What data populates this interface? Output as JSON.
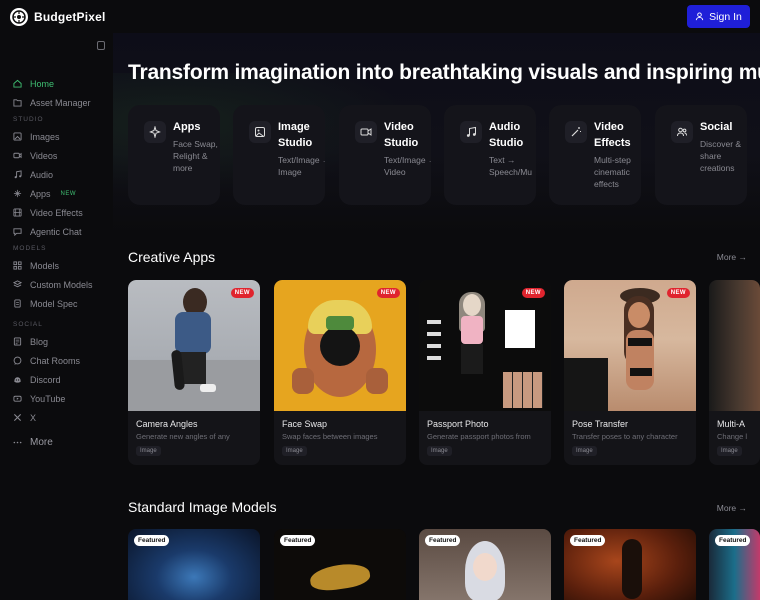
{
  "app": {
    "name": "BudgetPixel",
    "sign_in": "Sign In"
  },
  "sidebar": {
    "items_top": [
      {
        "label": "Home",
        "icon": "home-icon",
        "active": true
      },
      {
        "label": "Asset Manager",
        "icon": "folder-icon"
      }
    ],
    "section_studio": "STUDIO",
    "items_studio": [
      {
        "label": "Images",
        "icon": "image-icon"
      },
      {
        "label": "Videos",
        "icon": "video-icon"
      },
      {
        "label": "Audio",
        "icon": "music-icon"
      },
      {
        "label": "Apps",
        "icon": "sparkle-icon",
        "badge": "NEW"
      },
      {
        "label": "Video Effects",
        "icon": "film-icon"
      },
      {
        "label": "Agentic Chat",
        "icon": "chat-icon"
      }
    ],
    "section_models": "MODELS",
    "items_models": [
      {
        "label": "Models",
        "icon": "grid-icon"
      },
      {
        "label": "Custom Models",
        "icon": "layers-icon"
      },
      {
        "label": "Model Spec",
        "icon": "doc-icon"
      }
    ],
    "section_social": "SOCIAL",
    "items_social": [
      {
        "label": "Blog",
        "icon": "blog-icon"
      },
      {
        "label": "Chat Rooms",
        "icon": "chat-icon"
      },
      {
        "label": "Discord",
        "icon": "discord-icon"
      },
      {
        "label": "YouTube",
        "icon": "youtube-icon"
      },
      {
        "label": "X",
        "icon": "x-icon"
      }
    ],
    "more": "More"
  },
  "hero": {
    "title": "Transform imagination into breathtaking visuals and inspiring mu"
  },
  "studios": [
    {
      "title": "Apps",
      "desc": "Face Swap, Relight & more",
      "icon": "sparkle-icon"
    },
    {
      "title": "Image Studio",
      "desc": "Text/Image → Image",
      "icon": "image-icon"
    },
    {
      "title": "Video Studio",
      "desc": "Text/Image → Video",
      "icon": "video-icon"
    },
    {
      "title": "Audio Studio",
      "desc": "Text → Speech/Mu",
      "icon": "music-icon"
    },
    {
      "title": "Video Effects",
      "desc": "Multi-step cinematic effects",
      "icon": "wand-icon"
    },
    {
      "title": "Social",
      "desc": "Discover & share creations",
      "icon": "users-icon"
    }
  ],
  "creative_apps": {
    "title": "Creative Apps",
    "more": "More →",
    "items": [
      {
        "name": "Camera Angles",
        "desc": "Generate new angles of any",
        "tag": "Image",
        "badge": "NEW"
      },
      {
        "name": "Face Swap",
        "desc": "Swap faces between images",
        "tag": "Image",
        "badge": "NEW"
      },
      {
        "name": "Passport Photo",
        "desc": "Generate passport photos from",
        "tag": "Image",
        "badge": "NEW"
      },
      {
        "name": "Pose Transfer",
        "desc": "Transfer poses to any character",
        "tag": "Image",
        "badge": "NEW"
      },
      {
        "name": "Multi-A",
        "desc": "Change l",
        "tag": "Image"
      }
    ]
  },
  "standard_models": {
    "title": "Standard Image Models",
    "more": "More →",
    "items": [
      {
        "badge": "Featured"
      },
      {
        "badge": "Featured"
      },
      {
        "badge": "Featured"
      },
      {
        "badge": "Featured"
      },
      {
        "badge": "Featured"
      }
    ]
  },
  "colors": {
    "accent": "#1f1fd8",
    "active": "#3fbf72",
    "new": "#e0242e"
  }
}
